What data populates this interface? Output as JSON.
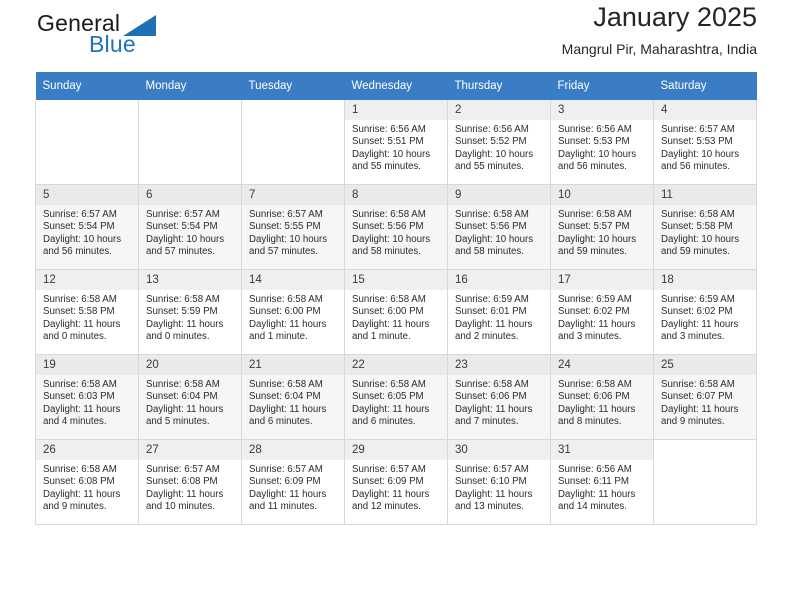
{
  "brand": {
    "name_part1": "General",
    "name_part2": "Blue",
    "logo_icon": "triangle-logo-icon",
    "accent_color": "#1e73be"
  },
  "header": {
    "title": "January 2025",
    "subtitle": "Mangrul Pir, Maharashtra, India"
  },
  "theme": {
    "header_row_bg": "#3b7dc4",
    "alt_row_bg": "#f6f6f6",
    "daynum_bg": "#efefef",
    "border": "#d8d8d8"
  },
  "calendar": {
    "weekday_headers": [
      "Sunday",
      "Monday",
      "Tuesday",
      "Wednesday",
      "Thursday",
      "Friday",
      "Saturday"
    ],
    "labels": {
      "sunrise": "Sunrise:",
      "sunset": "Sunset:",
      "daylight": "Daylight:"
    },
    "weeks": [
      [
        {
          "empty": true
        },
        {
          "empty": true
        },
        {
          "empty": true
        },
        {
          "day": "1",
          "sunrise": "Sunrise: 6:56 AM",
          "sunset": "Sunset: 5:51 PM",
          "daylight_1": "Daylight: 10 hours",
          "daylight_2": "and 55 minutes."
        },
        {
          "day": "2",
          "sunrise": "Sunrise: 6:56 AM",
          "sunset": "Sunset: 5:52 PM",
          "daylight_1": "Daylight: 10 hours",
          "daylight_2": "and 55 minutes."
        },
        {
          "day": "3",
          "sunrise": "Sunrise: 6:56 AM",
          "sunset": "Sunset: 5:53 PM",
          "daylight_1": "Daylight: 10 hours",
          "daylight_2": "and 56 minutes."
        },
        {
          "day": "4",
          "sunrise": "Sunrise: 6:57 AM",
          "sunset": "Sunset: 5:53 PM",
          "daylight_1": "Daylight: 10 hours",
          "daylight_2": "and 56 minutes."
        }
      ],
      [
        {
          "day": "5",
          "sunrise": "Sunrise: 6:57 AM",
          "sunset": "Sunset: 5:54 PM",
          "daylight_1": "Daylight: 10 hours",
          "daylight_2": "and 56 minutes."
        },
        {
          "day": "6",
          "sunrise": "Sunrise: 6:57 AM",
          "sunset": "Sunset: 5:54 PM",
          "daylight_1": "Daylight: 10 hours",
          "daylight_2": "and 57 minutes."
        },
        {
          "day": "7",
          "sunrise": "Sunrise: 6:57 AM",
          "sunset": "Sunset: 5:55 PM",
          "daylight_1": "Daylight: 10 hours",
          "daylight_2": "and 57 minutes."
        },
        {
          "day": "8",
          "sunrise": "Sunrise: 6:58 AM",
          "sunset": "Sunset: 5:56 PM",
          "daylight_1": "Daylight: 10 hours",
          "daylight_2": "and 58 minutes."
        },
        {
          "day": "9",
          "sunrise": "Sunrise: 6:58 AM",
          "sunset": "Sunset: 5:56 PM",
          "daylight_1": "Daylight: 10 hours",
          "daylight_2": "and 58 minutes."
        },
        {
          "day": "10",
          "sunrise": "Sunrise: 6:58 AM",
          "sunset": "Sunset: 5:57 PM",
          "daylight_1": "Daylight: 10 hours",
          "daylight_2": "and 59 minutes."
        },
        {
          "day": "11",
          "sunrise": "Sunrise: 6:58 AM",
          "sunset": "Sunset: 5:58 PM",
          "daylight_1": "Daylight: 10 hours",
          "daylight_2": "and 59 minutes."
        }
      ],
      [
        {
          "day": "12",
          "sunrise": "Sunrise: 6:58 AM",
          "sunset": "Sunset: 5:58 PM",
          "daylight_1": "Daylight: 11 hours",
          "daylight_2": "and 0 minutes."
        },
        {
          "day": "13",
          "sunrise": "Sunrise: 6:58 AM",
          "sunset": "Sunset: 5:59 PM",
          "daylight_1": "Daylight: 11 hours",
          "daylight_2": "and 0 minutes."
        },
        {
          "day": "14",
          "sunrise": "Sunrise: 6:58 AM",
          "sunset": "Sunset: 6:00 PM",
          "daylight_1": "Daylight: 11 hours",
          "daylight_2": "and 1 minute."
        },
        {
          "day": "15",
          "sunrise": "Sunrise: 6:58 AM",
          "sunset": "Sunset: 6:00 PM",
          "daylight_1": "Daylight: 11 hours",
          "daylight_2": "and 1 minute."
        },
        {
          "day": "16",
          "sunrise": "Sunrise: 6:59 AM",
          "sunset": "Sunset: 6:01 PM",
          "daylight_1": "Daylight: 11 hours",
          "daylight_2": "and 2 minutes."
        },
        {
          "day": "17",
          "sunrise": "Sunrise: 6:59 AM",
          "sunset": "Sunset: 6:02 PM",
          "daylight_1": "Daylight: 11 hours",
          "daylight_2": "and 3 minutes."
        },
        {
          "day": "18",
          "sunrise": "Sunrise: 6:59 AM",
          "sunset": "Sunset: 6:02 PM",
          "daylight_1": "Daylight: 11 hours",
          "daylight_2": "and 3 minutes."
        }
      ],
      [
        {
          "day": "19",
          "sunrise": "Sunrise: 6:58 AM",
          "sunset": "Sunset: 6:03 PM",
          "daylight_1": "Daylight: 11 hours",
          "daylight_2": "and 4 minutes."
        },
        {
          "day": "20",
          "sunrise": "Sunrise: 6:58 AM",
          "sunset": "Sunset: 6:04 PM",
          "daylight_1": "Daylight: 11 hours",
          "daylight_2": "and 5 minutes."
        },
        {
          "day": "21",
          "sunrise": "Sunrise: 6:58 AM",
          "sunset": "Sunset: 6:04 PM",
          "daylight_1": "Daylight: 11 hours",
          "daylight_2": "and 6 minutes."
        },
        {
          "day": "22",
          "sunrise": "Sunrise: 6:58 AM",
          "sunset": "Sunset: 6:05 PM",
          "daylight_1": "Daylight: 11 hours",
          "daylight_2": "and 6 minutes."
        },
        {
          "day": "23",
          "sunrise": "Sunrise: 6:58 AM",
          "sunset": "Sunset: 6:06 PM",
          "daylight_1": "Daylight: 11 hours",
          "daylight_2": "and 7 minutes."
        },
        {
          "day": "24",
          "sunrise": "Sunrise: 6:58 AM",
          "sunset": "Sunset: 6:06 PM",
          "daylight_1": "Daylight: 11 hours",
          "daylight_2": "and 8 minutes."
        },
        {
          "day": "25",
          "sunrise": "Sunrise: 6:58 AM",
          "sunset": "Sunset: 6:07 PM",
          "daylight_1": "Daylight: 11 hours",
          "daylight_2": "and 9 minutes."
        }
      ],
      [
        {
          "day": "26",
          "sunrise": "Sunrise: 6:58 AM",
          "sunset": "Sunset: 6:08 PM",
          "daylight_1": "Daylight: 11 hours",
          "daylight_2": "and 9 minutes."
        },
        {
          "day": "27",
          "sunrise": "Sunrise: 6:57 AM",
          "sunset": "Sunset: 6:08 PM",
          "daylight_1": "Daylight: 11 hours",
          "daylight_2": "and 10 minutes."
        },
        {
          "day": "28",
          "sunrise": "Sunrise: 6:57 AM",
          "sunset": "Sunset: 6:09 PM",
          "daylight_1": "Daylight: 11 hours",
          "daylight_2": "and 11 minutes."
        },
        {
          "day": "29",
          "sunrise": "Sunrise: 6:57 AM",
          "sunset": "Sunset: 6:09 PM",
          "daylight_1": "Daylight: 11 hours",
          "daylight_2": "and 12 minutes."
        },
        {
          "day": "30",
          "sunrise": "Sunrise: 6:57 AM",
          "sunset": "Sunset: 6:10 PM",
          "daylight_1": "Daylight: 11 hours",
          "daylight_2": "and 13 minutes."
        },
        {
          "day": "31",
          "sunrise": "Sunrise: 6:56 AM",
          "sunset": "Sunset: 6:11 PM",
          "daylight_1": "Daylight: 11 hours",
          "daylight_2": "and 14 minutes."
        },
        {
          "empty": true
        }
      ]
    ]
  }
}
